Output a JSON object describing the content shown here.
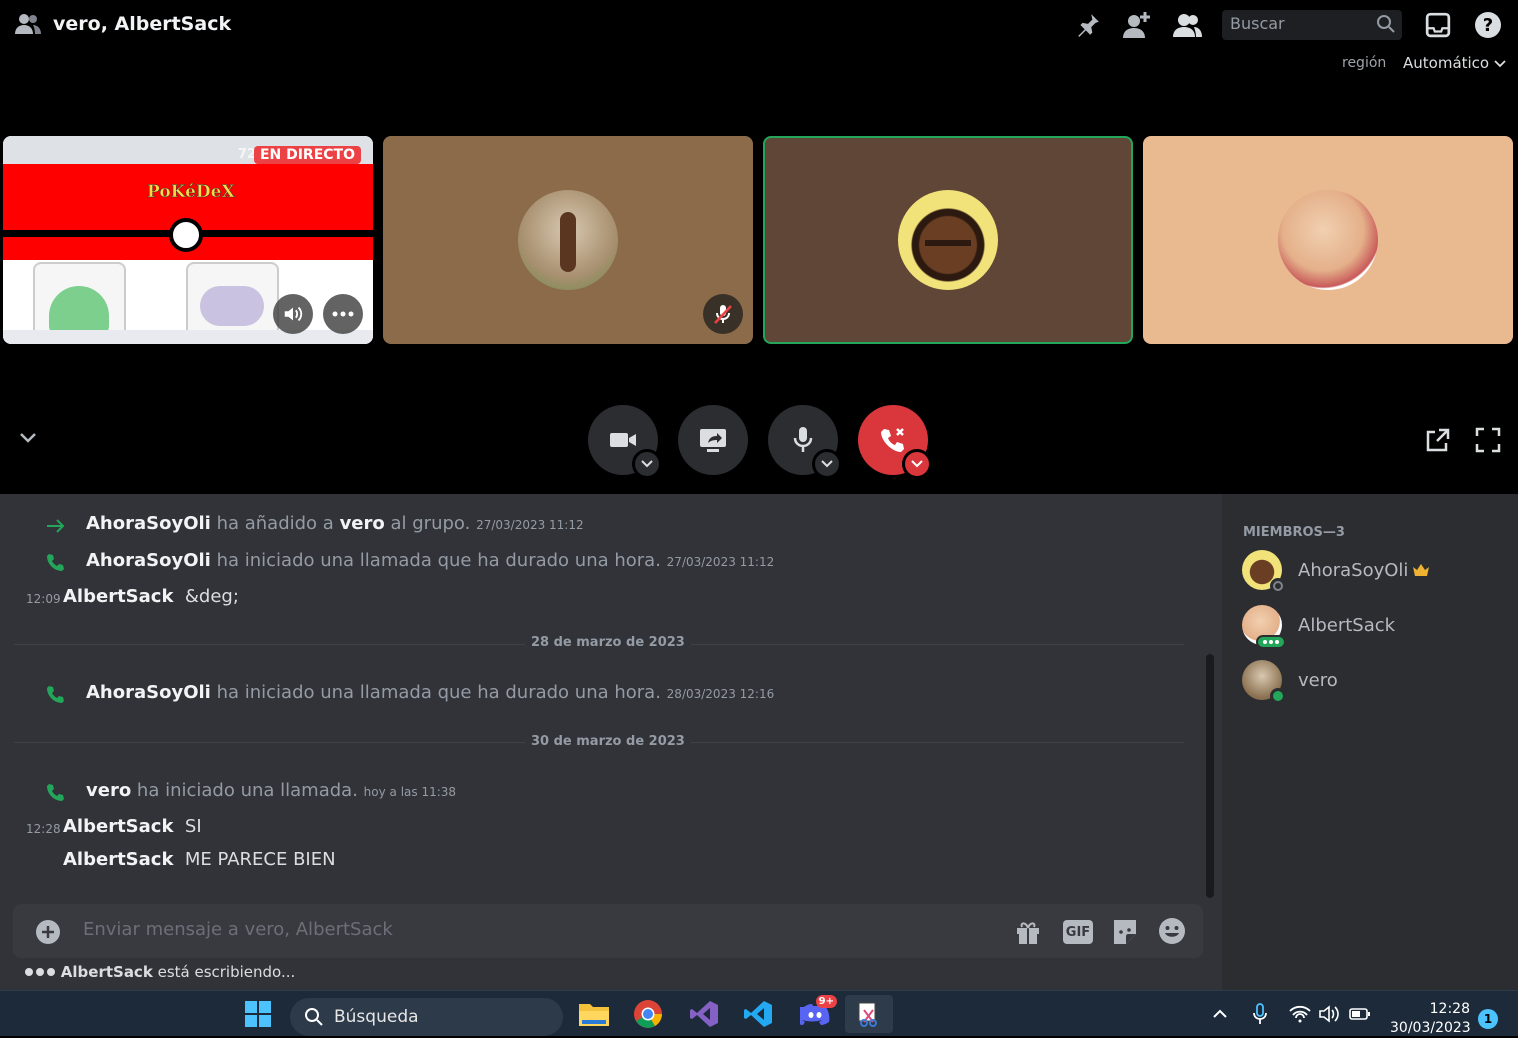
{
  "header": {
    "title": "vero, AlbertSack",
    "search_placeholder": "Buscar",
    "region_label": "región",
    "region_value": "Automático"
  },
  "stream": {
    "resolution": "720",
    "live_badge": "EN DIRECTO",
    "pokedex_label": "PoKéDeX"
  },
  "chat": {
    "messages": [
      {
        "actor": "AhoraSoyOli",
        "text1": "ha añadido a",
        "target": "vero",
        "text2": "al grupo.",
        "time": "27/03/2023 11:12"
      },
      {
        "actor": "AhoraSoyOli",
        "text": "ha iniciado una llamada que ha durado una hora.",
        "time": "27/03/2023 11:12"
      },
      {
        "time": "12:09",
        "author": "AlbertSack",
        "text": "&deg;"
      },
      {
        "divider": "28 de marzo de 2023"
      },
      {
        "actor": "AhoraSoyOli",
        "text": "ha iniciado una llamada que ha durado una hora.",
        "time": "28/03/2023 12:16"
      },
      {
        "divider": "30 de marzo de 2023"
      },
      {
        "actor": "vero",
        "text": "ha iniciado una llamada.",
        "time": "hoy a las 11:38"
      },
      {
        "time": "12:28",
        "author": "AlbertSack",
        "text": "SI"
      },
      {
        "author": "AlbertSack",
        "text": "ME PARECE BIEN"
      }
    ],
    "composer_placeholder": "Enviar mensaje a vero, AlbertSack",
    "gif_label": "GIF",
    "typing_user": "AlbertSack",
    "typing_text": "está escribiendo..."
  },
  "members": {
    "header": "MIEMBROS—3",
    "list": [
      {
        "name": "AhoraSoyOli",
        "owner_icon": "crown-icon"
      },
      {
        "name": "AlbertSack"
      },
      {
        "name": "vero"
      }
    ]
  },
  "taskbar": {
    "search_label": "Búsqueda",
    "discord_badge": "9+",
    "time": "12:28",
    "date": "30/03/2023",
    "notification_count": "1"
  }
}
